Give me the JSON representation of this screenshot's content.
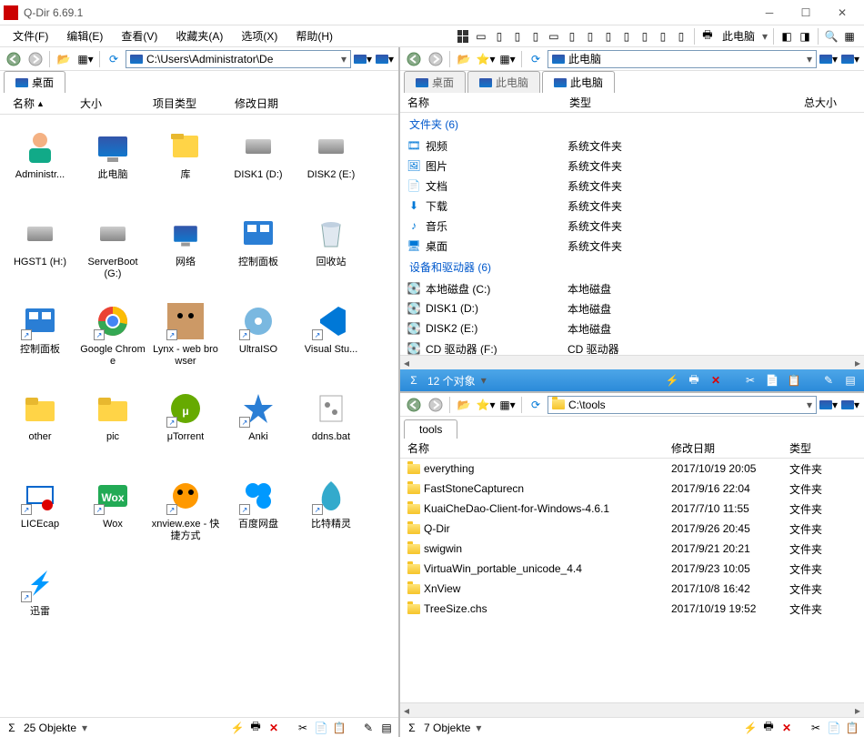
{
  "title": "Q-Dir 6.69.1",
  "menu": [
    "文件(F)",
    "编辑(E)",
    "查看(V)",
    "收藏夹(A)",
    "选项(X)",
    "帮助(H)"
  ],
  "top_right_label": "此电脑",
  "left": {
    "address": "C:\\Users\\Administrator\\De",
    "tab": "桌面",
    "headers": [
      "名称",
      "大小",
      "项目类型",
      "修改日期"
    ],
    "icons": [
      {
        "label": "Administr...",
        "kind": "user"
      },
      {
        "label": "此电脑",
        "kind": "pc"
      },
      {
        "label": "库",
        "kind": "libs"
      },
      {
        "label": "DISK1 (D:)",
        "kind": "drive"
      },
      {
        "label": "DISK2 (E:)",
        "kind": "drive"
      },
      {
        "label": "HGST1 (H:)",
        "kind": "drive"
      },
      {
        "label": "ServerBoot (G:)",
        "kind": "drive"
      },
      {
        "label": "网络",
        "kind": "network"
      },
      {
        "label": "控制面板",
        "kind": "cpanel"
      },
      {
        "label": "回收站",
        "kind": "trash"
      },
      {
        "label": "控制面板",
        "kind": "cpanel2",
        "shortcut": true
      },
      {
        "label": "Google Chrome",
        "kind": "chrome",
        "shortcut": true
      },
      {
        "label": "Lynx - web browser",
        "kind": "lynx",
        "shortcut": true
      },
      {
        "label": "UltraISO",
        "kind": "ultraiso",
        "shortcut": true
      },
      {
        "label": "Visual Stu...",
        "kind": "vscode",
        "shortcut": true
      },
      {
        "label": "other",
        "kind": "folder"
      },
      {
        "label": "pic",
        "kind": "folder"
      },
      {
        "label": "μTorrent",
        "kind": "utorrent",
        "shortcut": true
      },
      {
        "label": "Anki",
        "kind": "anki",
        "shortcut": true
      },
      {
        "label": "ddns.bat",
        "kind": "bat"
      },
      {
        "label": "LICEcap",
        "kind": "licecap",
        "shortcut": true
      },
      {
        "label": "Wox",
        "kind": "wox",
        "shortcut": true
      },
      {
        "label": "xnview.exe - 快捷方式",
        "kind": "xnview",
        "shortcut": true
      },
      {
        "label": "百度网盘",
        "kind": "baidu",
        "shortcut": true
      },
      {
        "label": "比特精灵",
        "kind": "bit",
        "shortcut": true
      },
      {
        "label": "迅雷",
        "kind": "xunlei",
        "shortcut": true
      }
    ],
    "status": "25 Objekte"
  },
  "right_top": {
    "address": "此电脑",
    "tabs": [
      "桌面",
      "此电脑",
      "此电脑"
    ],
    "headers": {
      "name": "名称",
      "type": "类型",
      "size": "总大小"
    },
    "group_folders_label": "文件夹 (6)",
    "folders": [
      {
        "name": "视频",
        "type": "系统文件夹",
        "icon": "video"
      },
      {
        "name": "图片",
        "type": "系统文件夹",
        "icon": "pic"
      },
      {
        "name": "文档",
        "type": "系统文件夹",
        "icon": "doc"
      },
      {
        "name": "下载",
        "type": "系统文件夹",
        "icon": "down"
      },
      {
        "name": "音乐",
        "type": "系统文件夹",
        "icon": "music"
      },
      {
        "name": "桌面",
        "type": "系统文件夹",
        "icon": "desk"
      }
    ],
    "group_drives_label": "设备和驱动器 (6)",
    "drives": [
      {
        "name": "本地磁盘 (C:)",
        "type": "本地磁盘"
      },
      {
        "name": "DISK1 (D:)",
        "type": "本地磁盘"
      },
      {
        "name": "DISK2 (E:)",
        "type": "本地磁盘"
      },
      {
        "name": "CD 驱动器 (F:)",
        "type": "CD 驱动器"
      }
    ],
    "midbar": "12 个对象"
  },
  "right_bot": {
    "address": "C:\\tools",
    "tab": "tools",
    "headers": {
      "name": "名称",
      "date": "修改日期",
      "type": "类型"
    },
    "rows": [
      {
        "name": "everything",
        "date": "2017/10/19 20:05",
        "type": "文件夹"
      },
      {
        "name": "FastStoneCapturecn",
        "date": "2017/9/16 22:04",
        "type": "文件夹"
      },
      {
        "name": "KuaiCheDao-Client-for-Windows-4.6.1",
        "date": "2017/7/10 11:55",
        "type": "文件夹"
      },
      {
        "name": "Q-Dir",
        "date": "2017/9/26 20:45",
        "type": "文件夹"
      },
      {
        "name": "swigwin",
        "date": "2017/9/21 20:21",
        "type": "文件夹"
      },
      {
        "name": "VirtuaWin_portable_unicode_4.4",
        "date": "2017/9/23 10:05",
        "type": "文件夹"
      },
      {
        "name": "XnView",
        "date": "2017/10/8 16:42",
        "type": "文件夹"
      },
      {
        "name": "TreeSize.chs",
        "date": "2017/10/19 19:52",
        "type": "文件夹"
      }
    ],
    "status": "7 Objekte"
  },
  "sigma": "Σ"
}
